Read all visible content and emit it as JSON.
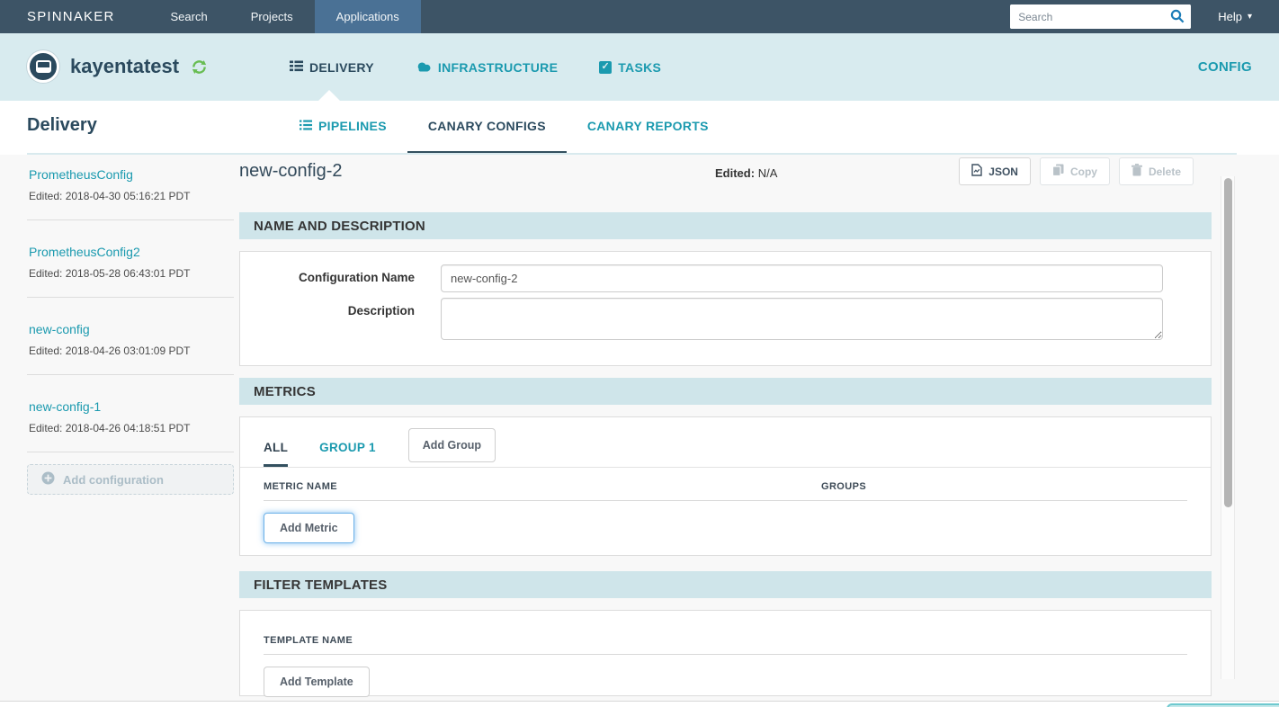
{
  "topnav": {
    "brand": "SPINNAKER",
    "items": [
      {
        "label": "Search",
        "active": false
      },
      {
        "label": "Projects",
        "active": false
      },
      {
        "label": "Applications",
        "active": true
      }
    ],
    "search_placeholder": "Search",
    "help_label": "Help"
  },
  "app_header": {
    "app_name": "kayentatest",
    "nav": [
      {
        "label": "DELIVERY",
        "icon": "task-list-icon",
        "active": true
      },
      {
        "label": "INFRASTRUCTURE",
        "icon": "cloud-icon",
        "active": false
      },
      {
        "label": "TASKS",
        "icon": "checked-box-icon",
        "active": false
      }
    ],
    "config_label": "CONFIG"
  },
  "delivery": {
    "title": "Delivery",
    "tabs": [
      {
        "label": "PIPELINES",
        "icon": "list-icon",
        "active": false
      },
      {
        "label": "CANARY CONFIGS",
        "active": true
      },
      {
        "label": "CANARY REPORTS",
        "active": false
      }
    ]
  },
  "sidebar": {
    "configs": [
      {
        "name": "PrometheusConfig",
        "edited": "Edited: 2018-04-30 05:16:21 PDT"
      },
      {
        "name": "PrometheusConfig2",
        "edited": "Edited: 2018-05-28 06:43:01 PDT"
      },
      {
        "name": "new-config",
        "edited": "Edited: 2018-04-26 03:01:09 PDT"
      },
      {
        "name": "new-config-1",
        "edited": "Edited: 2018-04-26 04:18:51 PDT"
      }
    ],
    "add_button_label": "Add configuration"
  },
  "detail": {
    "title": "new-config-2",
    "edited_label": "Edited:",
    "edited_value": "N/A",
    "buttons": {
      "json": "JSON",
      "copy": "Copy",
      "delete": "Delete"
    },
    "name_section": {
      "heading": "NAME AND DESCRIPTION",
      "name_label": "Configuration Name",
      "name_value": "new-config-2",
      "description_label": "Description",
      "description_value": ""
    },
    "metrics_section": {
      "heading": "METRICS",
      "tabs": [
        {
          "label": "ALL",
          "active": true
        },
        {
          "label": "GROUP 1",
          "active": false
        }
      ],
      "add_group_label": "Add Group",
      "columns": [
        "METRIC NAME",
        "GROUPS"
      ],
      "add_metric_label": "Add Metric"
    },
    "templates_section": {
      "heading": "FILTER TEMPLATES",
      "columns": [
        "TEMPLATE NAME"
      ],
      "add_template_label": "Add Template"
    }
  },
  "icons": {
    "app": "application-window-circle",
    "refresh": "refresh-arrows",
    "delivery": "task-list",
    "infrastructure": "cloud",
    "tasks": "checked-box",
    "search": "magnifier",
    "help_caret": "caret-down",
    "json": "document",
    "copy": "pages",
    "delete": "trash",
    "add_configuration": "plus-circle"
  },
  "colors": {
    "topnav_bg": "#3d5466",
    "topnav_active_bg": "#4a7195",
    "header_bg": "#d8ebef",
    "accent_teal": "#1b9aaf",
    "navy": "#2b4a5e",
    "section_band": "#cfe5ea",
    "refresh_green": "#68bd52",
    "focus_blue": "#52a8ec"
  }
}
